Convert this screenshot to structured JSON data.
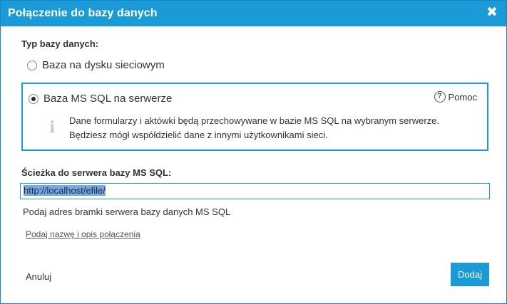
{
  "dialog": {
    "title": "Połączenie do bazy danych",
    "close_glyph": "✖"
  },
  "db_type": {
    "label": "Typ bazy danych:",
    "options": [
      {
        "label": "Baza na dysku sieciowym",
        "selected": false
      },
      {
        "label": "Baza MS SQL na serwerze",
        "selected": true
      }
    ],
    "help_label": "Pomoc",
    "description_line1": "Dane formularzy i aktówki będą przechowywane w bazie MS SQL na wybranym serwerze.",
    "description_line2": "Będziesz mógł współdzielić dane z innymi użytkownikami sieci."
  },
  "server_path": {
    "label": "Ścieżka do serwera bazy MS SQL:",
    "value": "http://localhost/efile/",
    "hint": "Podaj adres bramki serwera bazy danych MS SQL"
  },
  "connection_link": "Podaj nazwę i opis połączenia",
  "actions": {
    "cancel_label": "Anuluj",
    "add_label": "Dodaj"
  },
  "colors": {
    "accent": "#1a9ad6",
    "selection": "#7aa9e2"
  }
}
